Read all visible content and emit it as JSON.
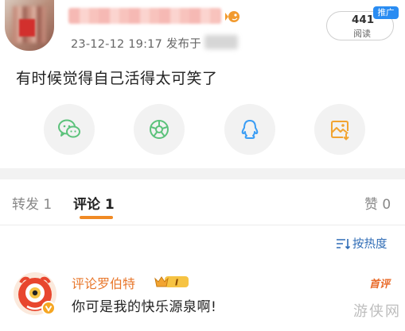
{
  "post": {
    "meta": "23-12-12 19:17  发布于",
    "read_count": "441",
    "read_label": "阅读",
    "promo_tag": "推广",
    "text": "有时候觉得自己活得太可笑了"
  },
  "share_buttons": [
    {
      "icon": "wechat-icon",
      "color": "#5cc27b"
    },
    {
      "icon": "moments-icon",
      "color": "#5cc27b"
    },
    {
      "icon": "qq-icon",
      "color": "#3a9df5"
    },
    {
      "icon": "save-image-icon",
      "color": "#f2a431"
    }
  ],
  "tabs": {
    "repost": "转发 1",
    "comment": "评论 1",
    "like": "赞 0"
  },
  "sort": {
    "label": "按热度"
  },
  "comment": {
    "name": "评论罗伯特",
    "badge_text": "I",
    "top_tag": "首评",
    "text": "你可是我的快乐源泉啊!"
  },
  "watermark": {
    "text": "游侠网"
  },
  "colors": {
    "accent_orange": "#f08a24",
    "link_blue": "#2f6cb6",
    "promo_blue": "#2a8cf2"
  }
}
